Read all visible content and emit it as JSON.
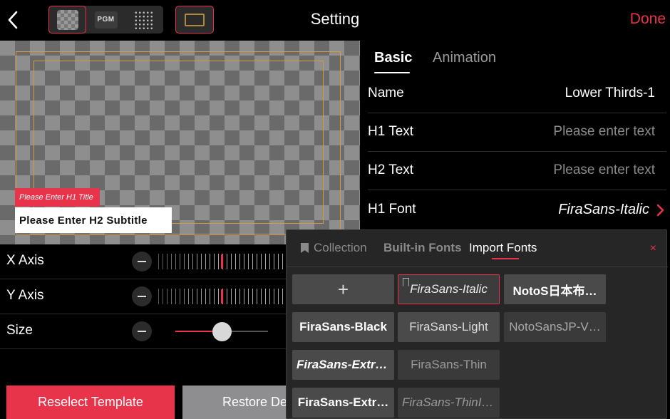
{
  "topbar": {
    "title": "Setting",
    "done_label": "Done",
    "view_modes": [
      {
        "name": "checker-view",
        "icon": "checker-icon",
        "active": true
      },
      {
        "name": "pgm-view",
        "label": "PGM",
        "active": false
      },
      {
        "name": "grid-view",
        "icon": "grid-dots-icon",
        "active": false
      }
    ],
    "safe_frame_icon": "safe-frame-icon"
  },
  "preview": {
    "h1_title": "Please Enter H1 Title",
    "h2_subtitle": "Please Enter H2 Subtitle"
  },
  "controls": {
    "x_axis_label": "X Axis",
    "y_axis_label": "Y Axis",
    "size_label": "Size",
    "size_level": 0.5
  },
  "buttons": {
    "reselect": "Reselect Template",
    "restore": "Restore Default"
  },
  "panel": {
    "tabs": [
      {
        "label": "Basic",
        "active": true
      },
      {
        "label": "Animation",
        "active": false
      }
    ],
    "rows": [
      {
        "label": "Name",
        "value": "Lower Thirds-1"
      },
      {
        "label": "H1 Text",
        "placeholder": "Please enter text"
      },
      {
        "label": "H2 Text",
        "placeholder": "Please enter text"
      },
      {
        "label": "H1 Font",
        "value": "FiraSans-Italic"
      }
    ]
  },
  "font_picker": {
    "tabs": [
      "Collection",
      "Built-in Fonts",
      "Import Fonts"
    ],
    "active_tab": "Import Fonts",
    "close_glyph": "×",
    "add_glyph": "+",
    "fonts": [
      "FiraSans-Italic",
      "NotoS日本布…",
      "FiraSans-Black",
      "FiraSans-Light",
      "NotoSansJP-V…",
      "FiraSans-Extra…",
      "FiraSans-Thin",
      "FiraSans-Extr…",
      "FiraSans-ThinIt…"
    ],
    "selected_font": "FiraSans-Italic"
  },
  "colors": {
    "accent": "#e8344a",
    "background": "#000000",
    "safe_frame": "#d49a45"
  }
}
